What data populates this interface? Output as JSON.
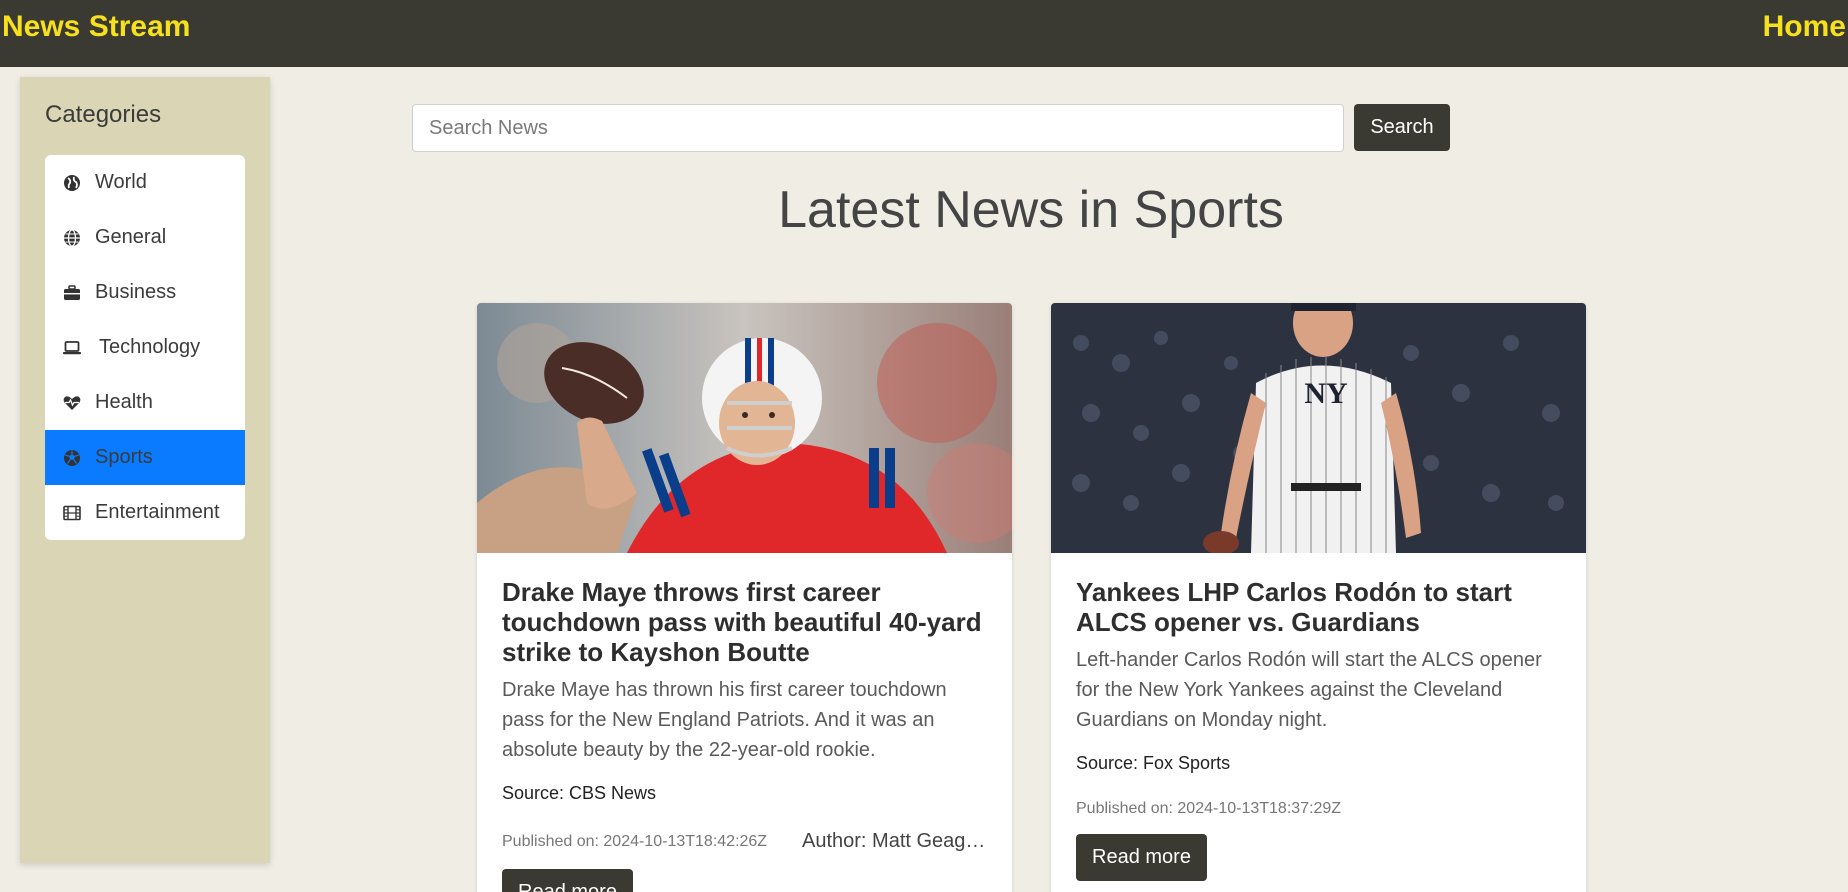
{
  "header": {
    "brand": "News Stream",
    "home_link": "Home",
    "brand_color": "#f7e11d",
    "bar_color": "#3a3a32"
  },
  "sidebar": {
    "title": "Categories",
    "active_color": "#0a7bff",
    "items": [
      {
        "label": "World",
        "icon": "earth-icon",
        "active": false
      },
      {
        "label": "General",
        "icon": "globe-icon",
        "active": false
      },
      {
        "label": "Business",
        "icon": "briefcase-icon",
        "active": false
      },
      {
        "label": "Technology",
        "icon": "laptop-icon",
        "active": false
      },
      {
        "label": "Health",
        "icon": "heartbeat-icon",
        "active": false
      },
      {
        "label": "Sports",
        "icon": "soccer-ball-icon",
        "active": true
      },
      {
        "label": "Entertainment",
        "icon": "film-icon",
        "active": false
      }
    ]
  },
  "search": {
    "placeholder": "Search News",
    "value": "",
    "button_label": "Search"
  },
  "main": {
    "title": "Latest News in Sports",
    "articles": [
      {
        "title": "Drake Maye throws first career touchdown pass with beautiful 40-yard strike to Kayshon Boutte",
        "description": "Drake Maye has thrown his first career touchdown pass for the New England Patriots. And it was an absolute beauty by the 22-year-old rookie.",
        "source": "Source: CBS News",
        "published": "Published on: 2024-10-13T18:42:26Z",
        "author": "Author: Matt Geagan",
        "read_more": "Read more"
      },
      {
        "title": "Yankees LHP Carlos Rodón to start ALCS opener vs. Guardians",
        "description": "Left-hander Carlos Rodón will start the ALCS opener for the New York Yankees against the Cleveland Guardians on Monday night.",
        "source": "Source: Fox Sports",
        "published": "Published on: 2024-10-13T18:37:29Z",
        "author": "",
        "read_more": "Read more"
      }
    ]
  }
}
